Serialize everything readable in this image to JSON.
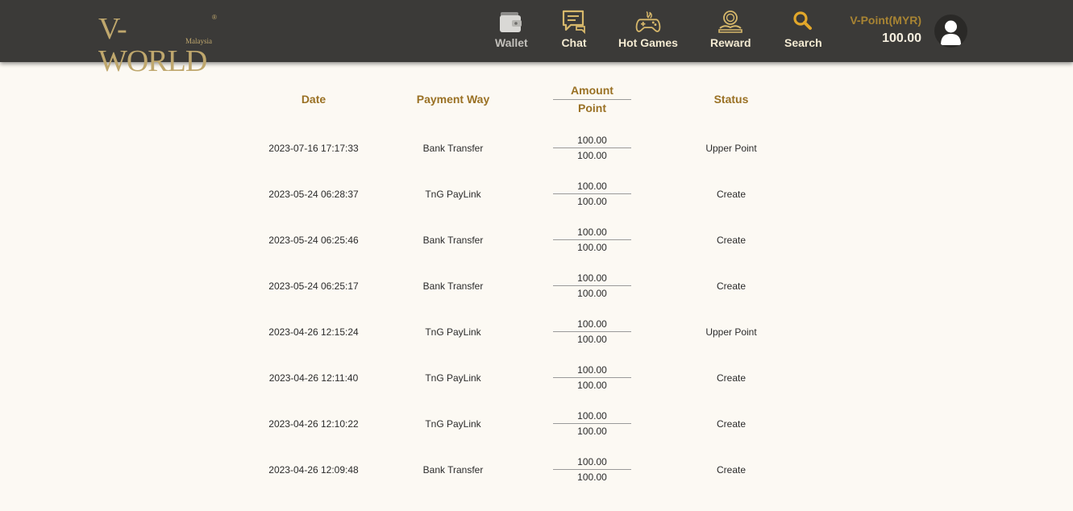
{
  "brand": {
    "logo_text": "V-WORLD",
    "logo_sub": "Malaysia",
    "logo_mark": "®",
    "colors": {
      "topbar": "#3b3a38",
      "gold": "#a88433",
      "background": "#fcf9f3"
    }
  },
  "nav": [
    {
      "label": "Wallet",
      "icon": "wallet-icon"
    },
    {
      "label": "Chat",
      "icon": "chat-icon"
    },
    {
      "label": "Hot Games",
      "icon": "gamepad-icon"
    },
    {
      "label": "Reward",
      "icon": "reward-icon"
    },
    {
      "label": "Search",
      "icon": "search-icon"
    }
  ],
  "account": {
    "currency_label": "V-Point(MYR)",
    "balance": "100.00",
    "avatar_icon": "user-icon"
  },
  "table": {
    "headers": {
      "date": "Date",
      "payment_way": "Payment Way",
      "amount": "Amount",
      "point": "Point",
      "status": "Status"
    },
    "rows": [
      {
        "date": "2023-07-16 17:17:33",
        "payment": "Bank Transfer",
        "amount": "100.00",
        "point": "100.00",
        "status": "Upper Point"
      },
      {
        "date": "2023-05-24 06:28:37",
        "payment": "TnG PayLink",
        "amount": "100.00",
        "point": "100.00",
        "status": "Create"
      },
      {
        "date": "2023-05-24 06:25:46",
        "payment": "Bank Transfer",
        "amount": "100.00",
        "point": "100.00",
        "status": "Create"
      },
      {
        "date": "2023-05-24 06:25:17",
        "payment": "Bank Transfer",
        "amount": "100.00",
        "point": "100.00",
        "status": "Create"
      },
      {
        "date": "2023-04-26 12:15:24",
        "payment": "TnG PayLink",
        "amount": "100.00",
        "point": "100.00",
        "status": "Upper Point"
      },
      {
        "date": "2023-04-26 12:11:40",
        "payment": "TnG PayLink",
        "amount": "100.00",
        "point": "100.00",
        "status": "Create"
      },
      {
        "date": "2023-04-26 12:10:22",
        "payment": "TnG PayLink",
        "amount": "100.00",
        "point": "100.00",
        "status": "Create"
      },
      {
        "date": "2023-04-26 12:09:48",
        "payment": "Bank Transfer",
        "amount": "100.00",
        "point": "100.00",
        "status": "Create"
      }
    ]
  }
}
